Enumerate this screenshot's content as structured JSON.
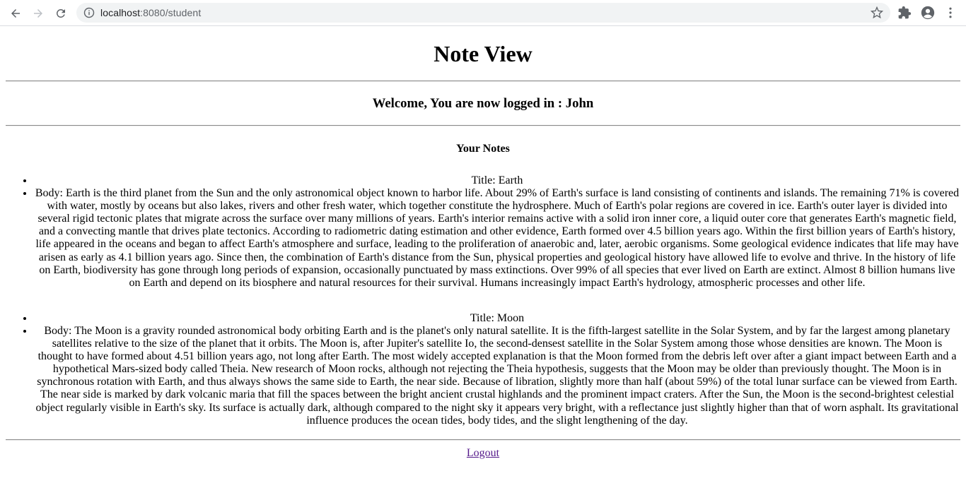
{
  "browser": {
    "url_host": "localhost",
    "url_rest": ":8080/student"
  },
  "page": {
    "title": "Note View",
    "welcome": "Welcome, You are now logged in : John",
    "notes_heading": "Your Notes",
    "logout_label": "Logout"
  },
  "notes": [
    {
      "title": "Title: Earth",
      "body": "Body: Earth is the third planet from the Sun and the only astronomical object known to harbor life. About 29% of Earth's surface is land consisting of continents and islands. The remaining 71% is covered with water, mostly by oceans but also lakes, rivers and other fresh water, which together constitute the hydrosphere. Much of Earth's polar regions are covered in ice. Earth's outer layer is divided into several rigid tectonic plates that migrate across the surface over many millions of years. Earth's interior remains active with a solid iron inner core, a liquid outer core that generates Earth's magnetic field, and a convecting mantle that drives plate tectonics. According to radiometric dating estimation and other evidence, Earth formed over 4.5 billion years ago. Within the first billion years of Earth's history, life appeared in the oceans and began to affect Earth's atmosphere and surface, leading to the proliferation of anaerobic and, later, aerobic organisms. Some geological evidence indicates that life may have arisen as early as 4.1 billion years ago. Since then, the combination of Earth's distance from the Sun, physical properties and geological history have allowed life to evolve and thrive. In the history of life on Earth, biodiversity has gone through long periods of expansion, occasionally punctuated by mass extinctions. Over 99% of all species that ever lived on Earth are extinct. Almost 8 billion humans live on Earth and depend on its biosphere and natural resources for their survival. Humans increasingly impact Earth's hydrology, atmospheric processes and other life."
    },
    {
      "title": "Title: Moon",
      "body": "Body: The Moon is a gravity rounded astronomical body orbiting Earth and is the planet's only natural satellite. It is the fifth-largest satellite in the Solar System, and by far the largest among planetary satellites relative to the size of the planet that it orbits. The Moon is, after Jupiter's satellite Io, the second-densest satellite in the Solar System among those whose densities are known. The Moon is thought to have formed about 4.51 billion years ago, not long after Earth. The most widely accepted explanation is that the Moon formed from the debris left over after a giant impact between Earth and a hypothetical Mars-sized body called Theia. New research of Moon rocks, although not rejecting the Theia hypothesis, suggests that the Moon may be older than previously thought. The Moon is in synchronous rotation with Earth, and thus always shows the same side to Earth, the near side. Because of libration, slightly more than half (about 59%) of the total lunar surface can be viewed from Earth. The near side is marked by dark volcanic maria that fill the spaces between the bright ancient crustal highlands and the prominent impact craters. After the Sun, the Moon is the second-brightest celestial object regularly visible in Earth's sky. Its surface is actually dark, although compared to the night sky it appears very bright, with a reflectance just slightly higher than that of worn asphalt. Its gravitational influence produces the ocean tides, body tides, and the slight lengthening of the day."
    }
  ]
}
